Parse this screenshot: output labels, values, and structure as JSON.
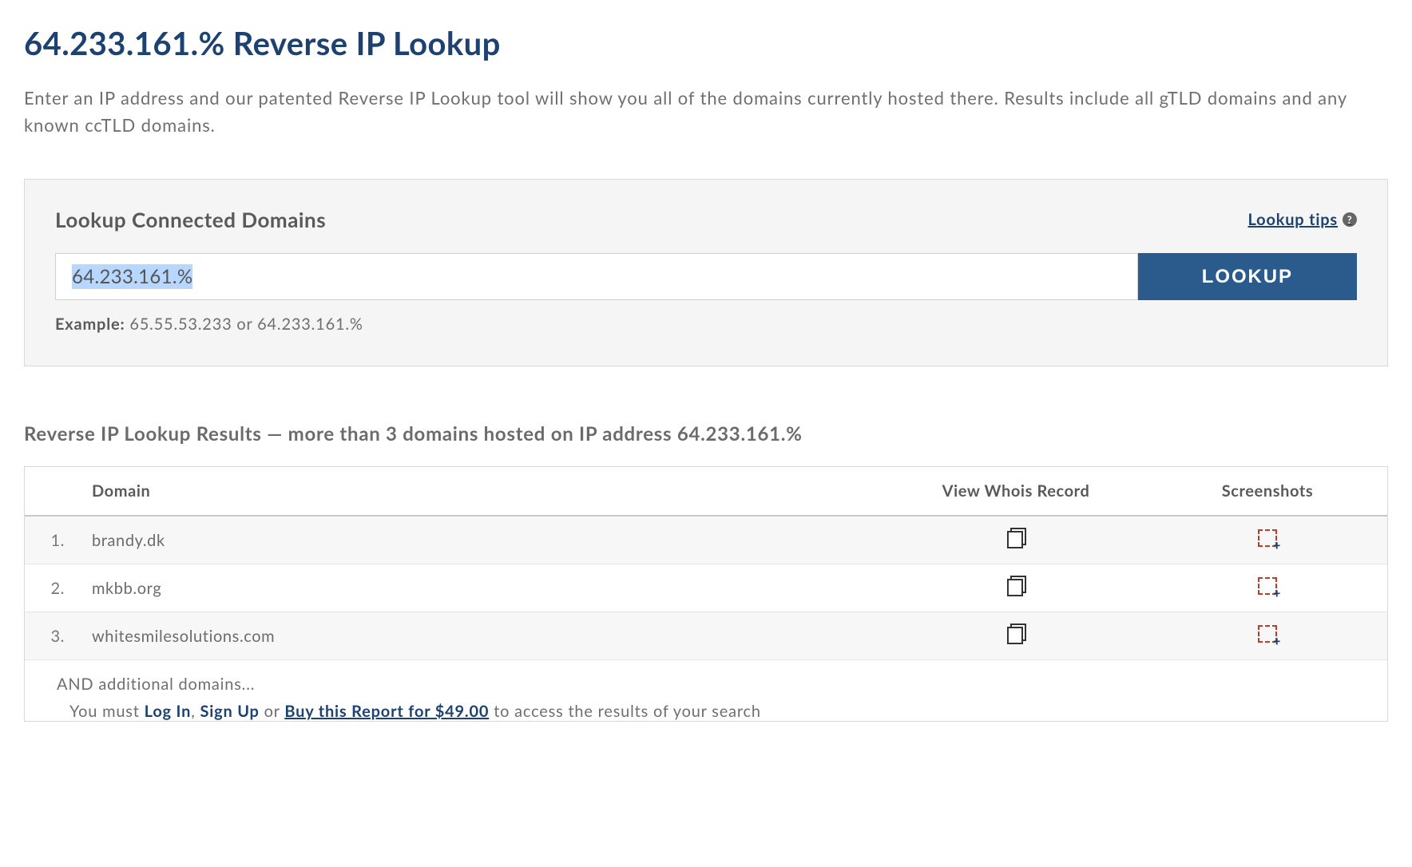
{
  "page": {
    "title": "64.233.161.% Reverse IP Lookup",
    "intro": "Enter an IP address and our patented Reverse IP Lookup tool will show you all of the domains currently hosted there. Results include all gTLD domains and any known ccTLD domains."
  },
  "lookup": {
    "heading": "Lookup Connected Domains",
    "tips_label": "Lookup tips",
    "input_value": "64.233.161.%",
    "button_label": "LOOKUP",
    "example_label": "Example:",
    "example_value": "65.55.53.233 or 64.233.161.%"
  },
  "results": {
    "heading": "Reverse IP Lookup Results — more than 3 domains hosted on IP address 64.233.161.%",
    "columns": {
      "domain": "Domain",
      "whois": "View Whois Record",
      "screenshots": "Screenshots"
    },
    "rows": [
      {
        "idx": "1.",
        "domain": "brandy.dk"
      },
      {
        "idx": "2.",
        "domain": "mkbb.org"
      },
      {
        "idx": "3.",
        "domain": "whitesmilesolutions.com"
      }
    ],
    "and_more": "AND additional domains...",
    "must_prefix": "You must ",
    "login": "Log In",
    "comma": ", ",
    "signup": "Sign Up",
    "or": " or ",
    "buy": "Buy this Report for $49.00",
    "must_suffix": " to access the results of your search"
  }
}
